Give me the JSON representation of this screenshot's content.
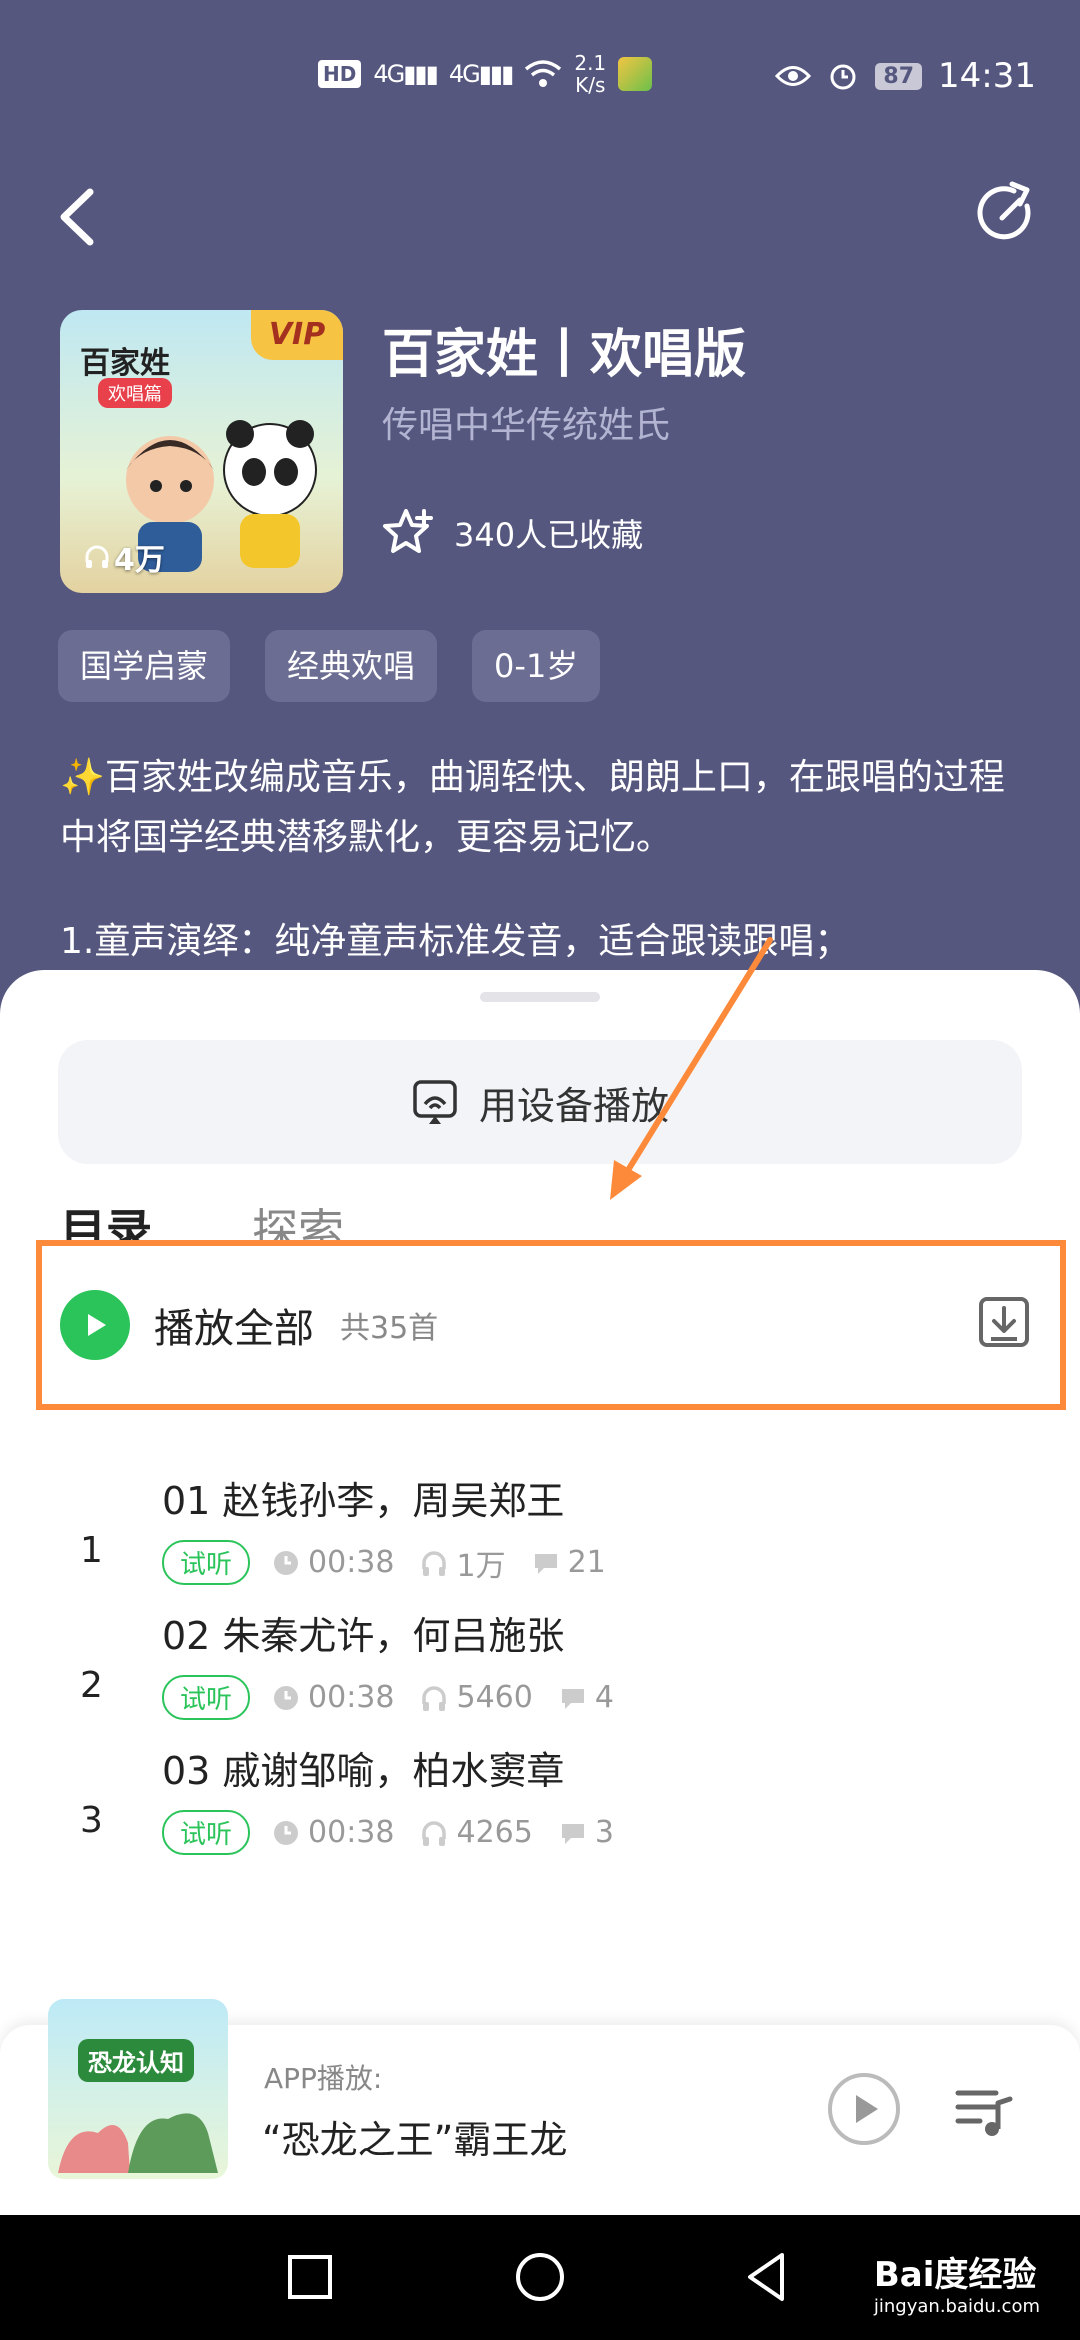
{
  "status_bar": {
    "hd": "HD",
    "sig1": "4G",
    "sig2": "4G",
    "speed_value": "2.1",
    "speed_unit": "K/s",
    "battery": "87",
    "time": "14:31"
  },
  "album": {
    "cover_title": "百家姓",
    "cover_subtitle": "欢唱篇",
    "cover_vip": "VIP",
    "cover_plays": "4万",
    "title": "百家姓丨欢唱版",
    "subtitle": "传唱中华传统姓氏",
    "favorites": "340人已收藏",
    "tags": [
      "国学启蒙",
      "经典欢唱",
      "0-1岁"
    ],
    "description": "✨百家姓改编成音乐，曲调轻快、朗朗上口，在跟唱的过程中将国学经典潜移默化，更容易记忆。",
    "description_point": "1.童声演绎：纯净童声标准发音，适合跟读跟唱；"
  },
  "sheet": {
    "device_play": "用设备播放",
    "tabs": [
      "目录",
      "探索"
    ],
    "play_all": "播放全部",
    "track_count": "共35首",
    "trial_label": "试听",
    "tracks": [
      {
        "num": "1",
        "title": "01 赵钱孙李，周吴郑王",
        "duration": "00:38",
        "plays": "1万",
        "comments": "21"
      },
      {
        "num": "2",
        "title": "02 朱秦尤许，何吕施张",
        "duration": "00:38",
        "plays": "5460",
        "comments": "4"
      },
      {
        "num": "3",
        "title": "03 戚谢邹喻，柏水窦章",
        "duration": "00:38",
        "plays": "4265",
        "comments": "3"
      }
    ]
  },
  "mini_player": {
    "cover_label": "恐龙认知",
    "source": "APP播放:",
    "title": "“恐龙之王”霸王龙"
  },
  "watermark": {
    "brand": "Bai度经验",
    "url": "jingyan.baidu.com"
  },
  "colors": {
    "header_bg": "#56577f",
    "accent_green": "#2bc45a",
    "annotation_orange": "#fd8a3a"
  }
}
